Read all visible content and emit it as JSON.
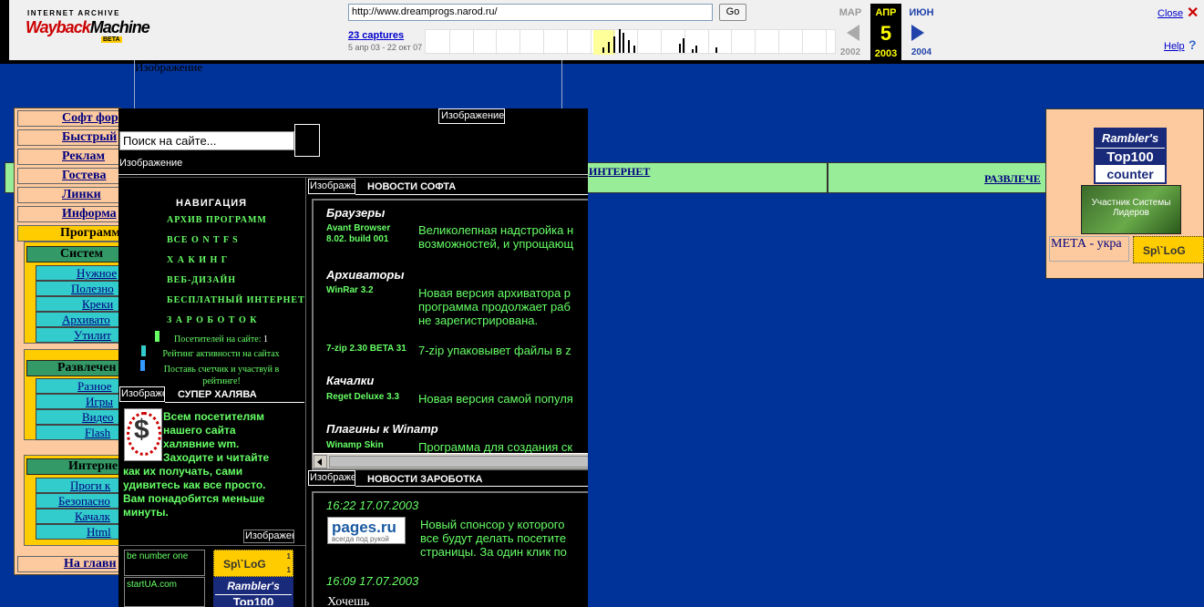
{
  "wayback": {
    "logo_top": "INTERNET ARCHIVE",
    "logo_way": "Wayback",
    "logo_machine": "Machine",
    "logo_beta": "BETA",
    "url": "http://www.dreamprogs.narod.ru/",
    "go_label": "Go",
    "captures_label": "23 captures",
    "captures_range": "5 апр 03 - 22 окт 07",
    "prev_month": "МАР",
    "current_month": "АПР",
    "current_day": "5",
    "current_year": "2003",
    "next_month": "ИЮН",
    "prev_year": "2002",
    "next_year": "2004",
    "close_label": "Close",
    "help_label": "Help",
    "spark_bars": [
      6,
      12,
      18,
      26,
      22,
      14,
      8,
      10,
      16,
      4,
      8,
      6
    ]
  },
  "page": {
    "top_frame_image": "Изображение",
    "left_menu": {
      "items_top": [
        "Софт фор",
        "Быстрый",
        "Реклам",
        "Гостева",
        "Линки",
        "Информа"
      ],
      "programs_label": "Программ",
      "groups": [
        {
          "title": "Систем",
          "items": [
            "Нужное",
            "Полезно",
            "Креки",
            "Архивато",
            "Утилит"
          ]
        },
        {
          "title": "Развлечен",
          "items": [
            "Разное",
            "Игры",
            "Видео",
            "Flash"
          ]
        },
        {
          "title": "Интерне",
          "items": [
            "Проги к",
            "Безопасно",
            "Качалк",
            "Html"
          ]
        }
      ],
      "home_label": "На главн"
    },
    "green_bar": {
      "internet_label": "ИНТЕРНЕТ",
      "entertainment_label": "РАЗВЛЕЧЕ"
    },
    "right_panel": {
      "rambler_a": "Rambler's",
      "rambler_b": "Top100",
      "rambler_c": "counter",
      "leader_text": "Участник Системы Лидеров",
      "meta_text": "МЕТА - укра",
      "splog_text": "Sp\\`LoG"
    }
  },
  "frame": {
    "top_image": "Изображение",
    "search_placeholder": "Поиск на сайте...",
    "image_under_search": "Изображение",
    "nav_title": "НАВИГАЦИЯ",
    "nav_links": [
      "АРХИВ ПРОГРАММ",
      "ВСЕ О N T F S",
      "Х А К И Н Г",
      "ВЕБ-ДИЗАЙН",
      "БЕСПЛАТНЫЙ ИНТЕРНЕТ",
      "З А Р О Б О Т О К"
    ],
    "visitors_label": "Посетителей на сайте: ",
    "visitors_count": "1",
    "rating_label": "Рейтинг активности на сайтах",
    "counter_label": "Поставь счетчик и участвуй в рейтинге!",
    "halyava_img": "Изображение",
    "halyava_title": "СУПЕР ХАЛЯВА",
    "halyava_lines_indented": [
      "Всем посетителям",
      "нашего сайта",
      "халявние wm.",
      "Заходите и читайте"
    ],
    "halyava_lines_full": [
      "как их получать, сами",
      "удивитесь как все просто.",
      "Вам понадобится меньше",
      "минуты."
    ],
    "image_mid": "Изображение",
    "counter_a": "be number one",
    "counter_b": "startUA.com",
    "splog_text": "Sp\\`LoG",
    "splog_n": "1",
    "rambler_a": "Rambler's",
    "rambler_b": "Top100",
    "soft": {
      "img": "Изображение",
      "title": "НОВОСТИ СОФТА",
      "sections": [
        {
          "category": "Браузеры",
          "product": "Avant Browser 8.02. build 001",
          "desc": [
            "Великолепная надстройка н",
            "возможностей, и упрощающ"
          ]
        },
        {
          "category": "Архиваторы",
          "product": "WinRar 3.2",
          "desc": [
            "Новая версия архиватора р",
            "программа продолжает раб",
            "не зарегистрирована."
          ]
        },
        {
          "category": "",
          "product": "7-zip 2.30 BETA 31",
          "desc": [
            "7-zip упаковывет файлы в z"
          ]
        },
        {
          "category": "Качалки",
          "product": "Reget Deluxe 3.3",
          "desc": [
            "Новая версия самой популя"
          ]
        },
        {
          "category": "Плагины к Winamp",
          "product": "Winamp Skin",
          "desc": [
            "Программа для создания ск"
          ]
        }
      ]
    },
    "earn": {
      "img": "Изображение",
      "title": "НОВОСТИ ЗАРОБОТКА",
      "time1": "16:22 17.07.2003",
      "logo_a": "pages.ru",
      "logo_b": "всегда под рукой",
      "desc": [
        "Новый спонсор у которого",
        "все будут делать посетите",
        "страницы. За один клик по"
      ],
      "time2": "16:09 17.07.2003",
      "more": "Хочешь"
    }
  }
}
